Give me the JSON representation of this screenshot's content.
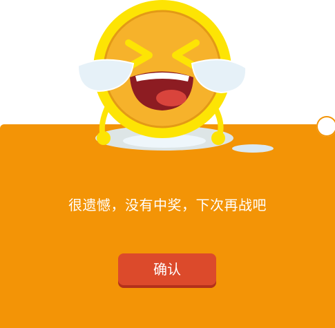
{
  "dialog": {
    "message": "很遗憾，没有中奖，下次再战吧",
    "confirm_label": "确认",
    "mascot_icon": "crying-coin-icon",
    "close_icon": "close-icon"
  },
  "colors": {
    "panel": "#f39406",
    "button": "#dc4a2b",
    "text": "#ffffff",
    "coin": "#f7b52d",
    "coin_rim": "#fde404"
  }
}
